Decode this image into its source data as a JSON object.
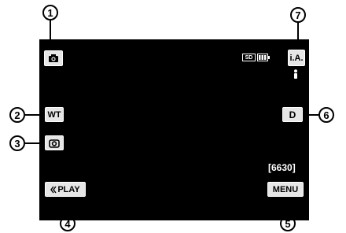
{
  "callouts": [
    "1",
    "2",
    "3",
    "4",
    "5",
    "6",
    "7"
  ],
  "buttons": {
    "capture_mode_icon": "camera-icon",
    "tele_wide_label": "WT",
    "snapshot_icon": "snapshot-camera-icon",
    "play_label": "PLAY",
    "play_icon": "double-chevron-left-icon",
    "menu_label": "MENU",
    "display_label": "D",
    "intelligent_auto_label": "i.A."
  },
  "status": {
    "sd_label": "SD",
    "battery_icon": "battery-icon",
    "scene_icon": "portrait-icon",
    "remaining_shots": "[6630]"
  },
  "colors": {
    "screen_background": "#000000",
    "button_background": "#e6e6e6",
    "callout_border": "#000000"
  }
}
